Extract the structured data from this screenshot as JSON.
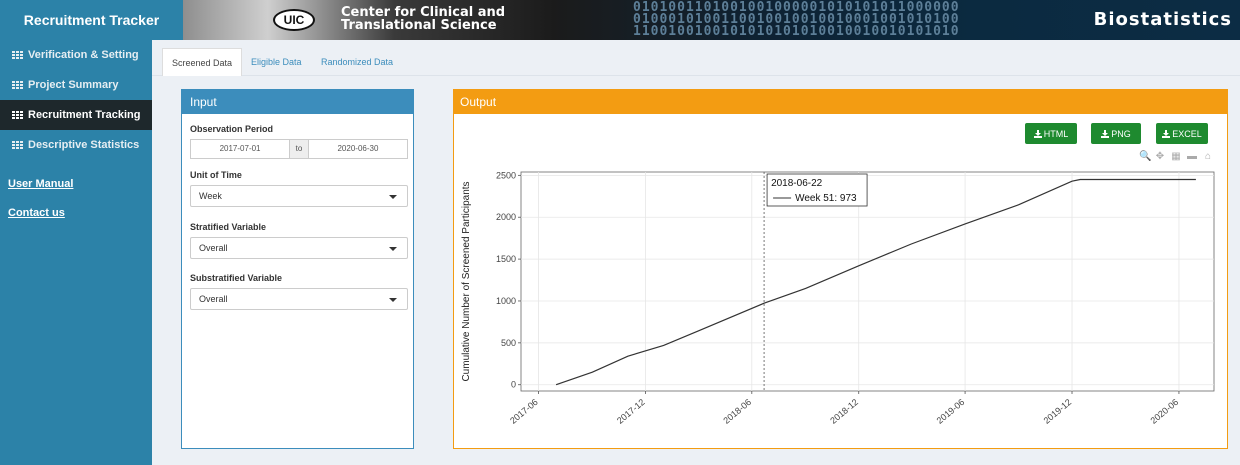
{
  "app": {
    "title": "Recruitment Tracker",
    "banner": {
      "logo": "UIC",
      "center_line1": "Center for Clinical and",
      "center_line2": "Translational Science",
      "right_text": "Biostatistics",
      "binary_line1": "0101001101001001000001010101011000000",
      "binary_line2": "0100010100110010010010010001001010100",
      "binary_line3": "1100100100101010101010010010010101010"
    }
  },
  "sidebar": {
    "items": [
      {
        "label": "Verification & Setting",
        "icon": "table-icon"
      },
      {
        "label": "Project Summary",
        "icon": "table-icon"
      },
      {
        "label": "Recruitment Tracking",
        "icon": "table-icon"
      },
      {
        "label": "Descriptive Statistics",
        "icon": "table-icon"
      }
    ],
    "links": [
      "User Manual",
      "Contact us"
    ]
  },
  "tabs": [
    "Screened Data",
    "Eligible Data",
    "Randomized Data"
  ],
  "input": {
    "title": "Input",
    "observation_label": "Observation Period",
    "date_start": "2017-07-01",
    "date_sep": "to",
    "date_end": "2020-06-30",
    "unit_label": "Unit of Time",
    "unit_value": "Week",
    "strat_label": "Stratified Variable",
    "strat_value": "Overall",
    "substrat_label": "Substratified Variable",
    "substrat_value": "Overall"
  },
  "output": {
    "title": "Output",
    "buttons": [
      "HTML",
      "PNG",
      "EXCEL"
    ]
  },
  "colors": {
    "sidebar": "#2c82a8",
    "active": "#1e282c",
    "input": "#3c8dbc",
    "output": "#f39c12",
    "button": "#1e8a2f"
  },
  "chart_data": {
    "type": "line",
    "ylabel": "Cumulative Number of Screened Participants",
    "xlabel": "",
    "yticks": [
      0,
      500,
      1000,
      1500,
      2000,
      2500
    ],
    "ylim": [
      -75,
      2540
    ],
    "xlim": [
      "2017-05-02",
      "2020-07-31"
    ],
    "xticks": [
      "2017-06",
      "2017-12",
      "2018-06",
      "2018-12",
      "2019-06",
      "2019-12",
      "2020-06"
    ],
    "grid": true,
    "series": [
      {
        "x": [
          "2017-07-01",
          "2017-09-01",
          "2017-11-01",
          "2018-01-01",
          "2018-03-01",
          "2018-06-22",
          "2018-09-01",
          "2018-12-01",
          "2019-03-01",
          "2019-06-01",
          "2019-09-01",
          "2019-12-01",
          "2019-12-15",
          "2020-06-30"
        ],
        "values": [
          0,
          150,
          340,
          470,
          640,
          973,
          1150,
          1420,
          1680,
          1920,
          2150,
          2430,
          2450,
          2450
        ]
      }
    ],
    "tooltip": {
      "date": "2018-06-22",
      "text": "Week 51: 973"
    }
  }
}
